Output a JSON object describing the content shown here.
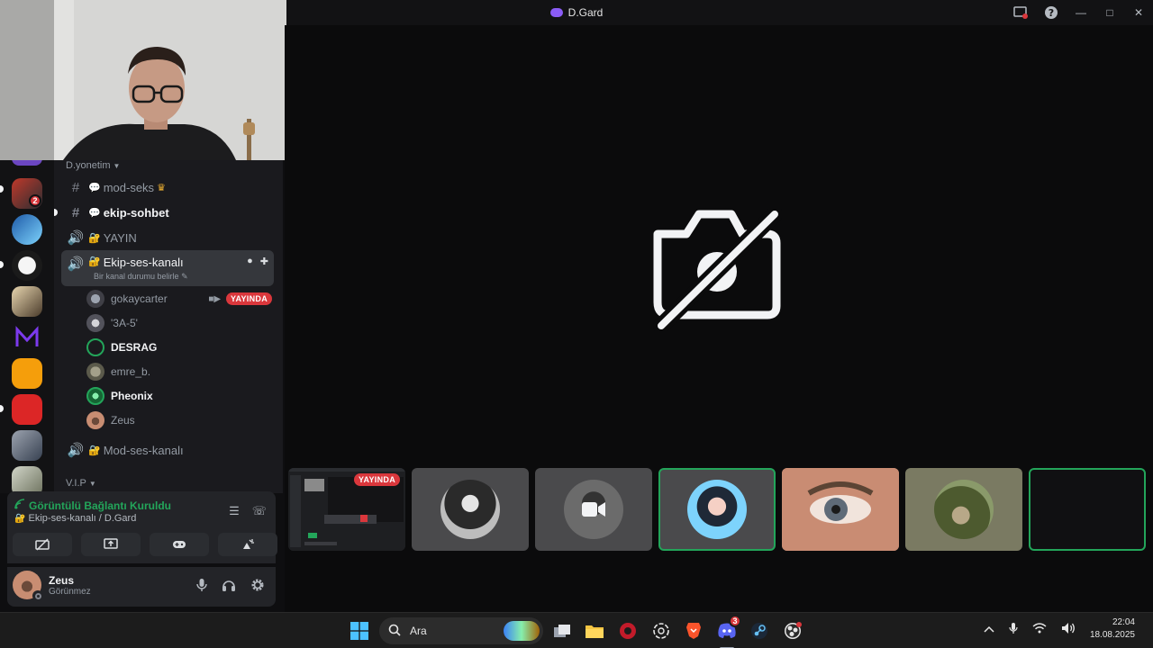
{
  "window": {
    "title": "D.Gard"
  },
  "servers": {
    "ready_badge": "2"
  },
  "channels": {
    "category_yonetim": "D.yonetim",
    "mod_seks": "mod-seks",
    "ekip_sohbet": "ekip-sohbet",
    "yayin": "YAYIN",
    "ekip_ses_kanali": "Ekip-ses-kanalı",
    "status_placeholder": "Bir kanal durumu belirle",
    "mod_ses_kanali": "Mod-ses-kanalı",
    "category_vip": "V.I.P"
  },
  "members": [
    {
      "name": "gokaycarter",
      "live": "YAYINDA"
    },
    {
      "name": "'3A-5'"
    },
    {
      "name": "DESRAG"
    },
    {
      "name": "emre_b."
    },
    {
      "name": "Pheonix"
    },
    {
      "name": "Zeus"
    }
  ],
  "voice": {
    "status": "Görüntülü Bağlantı Kuruldu",
    "channel_path": "Ekip-ses-kanalı / D.Gard"
  },
  "user": {
    "name": "Zeus",
    "status": "Görünmez"
  },
  "stage": {
    "live_badge": "YAYINDA"
  },
  "taskbar": {
    "search_label": "Ara",
    "discord_badge": "3",
    "time": "22:04",
    "date": "18.08.2025"
  },
  "colors": {
    "live": "#da373c",
    "connected": "#23a55a",
    "accent": "#8b5cf6"
  }
}
